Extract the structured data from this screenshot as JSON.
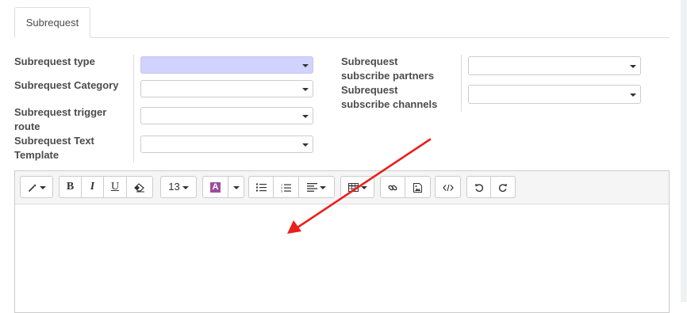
{
  "tabs": [
    {
      "label": "Subrequest"
    }
  ],
  "form": {
    "left_fields": [
      {
        "label": "Subrequest type"
      },
      {
        "label": "Subrequest Category"
      },
      {
        "label_line1": "Subrequest trigger",
        "label_line2": "route"
      },
      {
        "label_line1": "Subrequest Text",
        "label_line2": "Template"
      }
    ],
    "right_fields": [
      {
        "label_line1": "Subrequest",
        "label_line2": "subscribe partners"
      },
      {
        "label_line1": "Subrequest",
        "label_line2": "subscribe channels"
      }
    ]
  },
  "editor": {
    "toolbar": {
      "font_size": "13",
      "bold": "B",
      "italic": "I",
      "underline": "U",
      "color_letter": "A",
      "icons": [
        "magic-wand-icon",
        "eraser-icon",
        "list-ul-icon",
        "list-ol-icon",
        "align-icon",
        "table-icon",
        "link-icon",
        "image-icon",
        "code-view-icon",
        "undo-icon",
        "redo-icon"
      ]
    },
    "body_text": ""
  },
  "colors": {
    "required_field_bg": "#d2d2ff",
    "annotation_arrow": "#e8201c",
    "font_color_swatch": "#9c4d9c"
  }
}
